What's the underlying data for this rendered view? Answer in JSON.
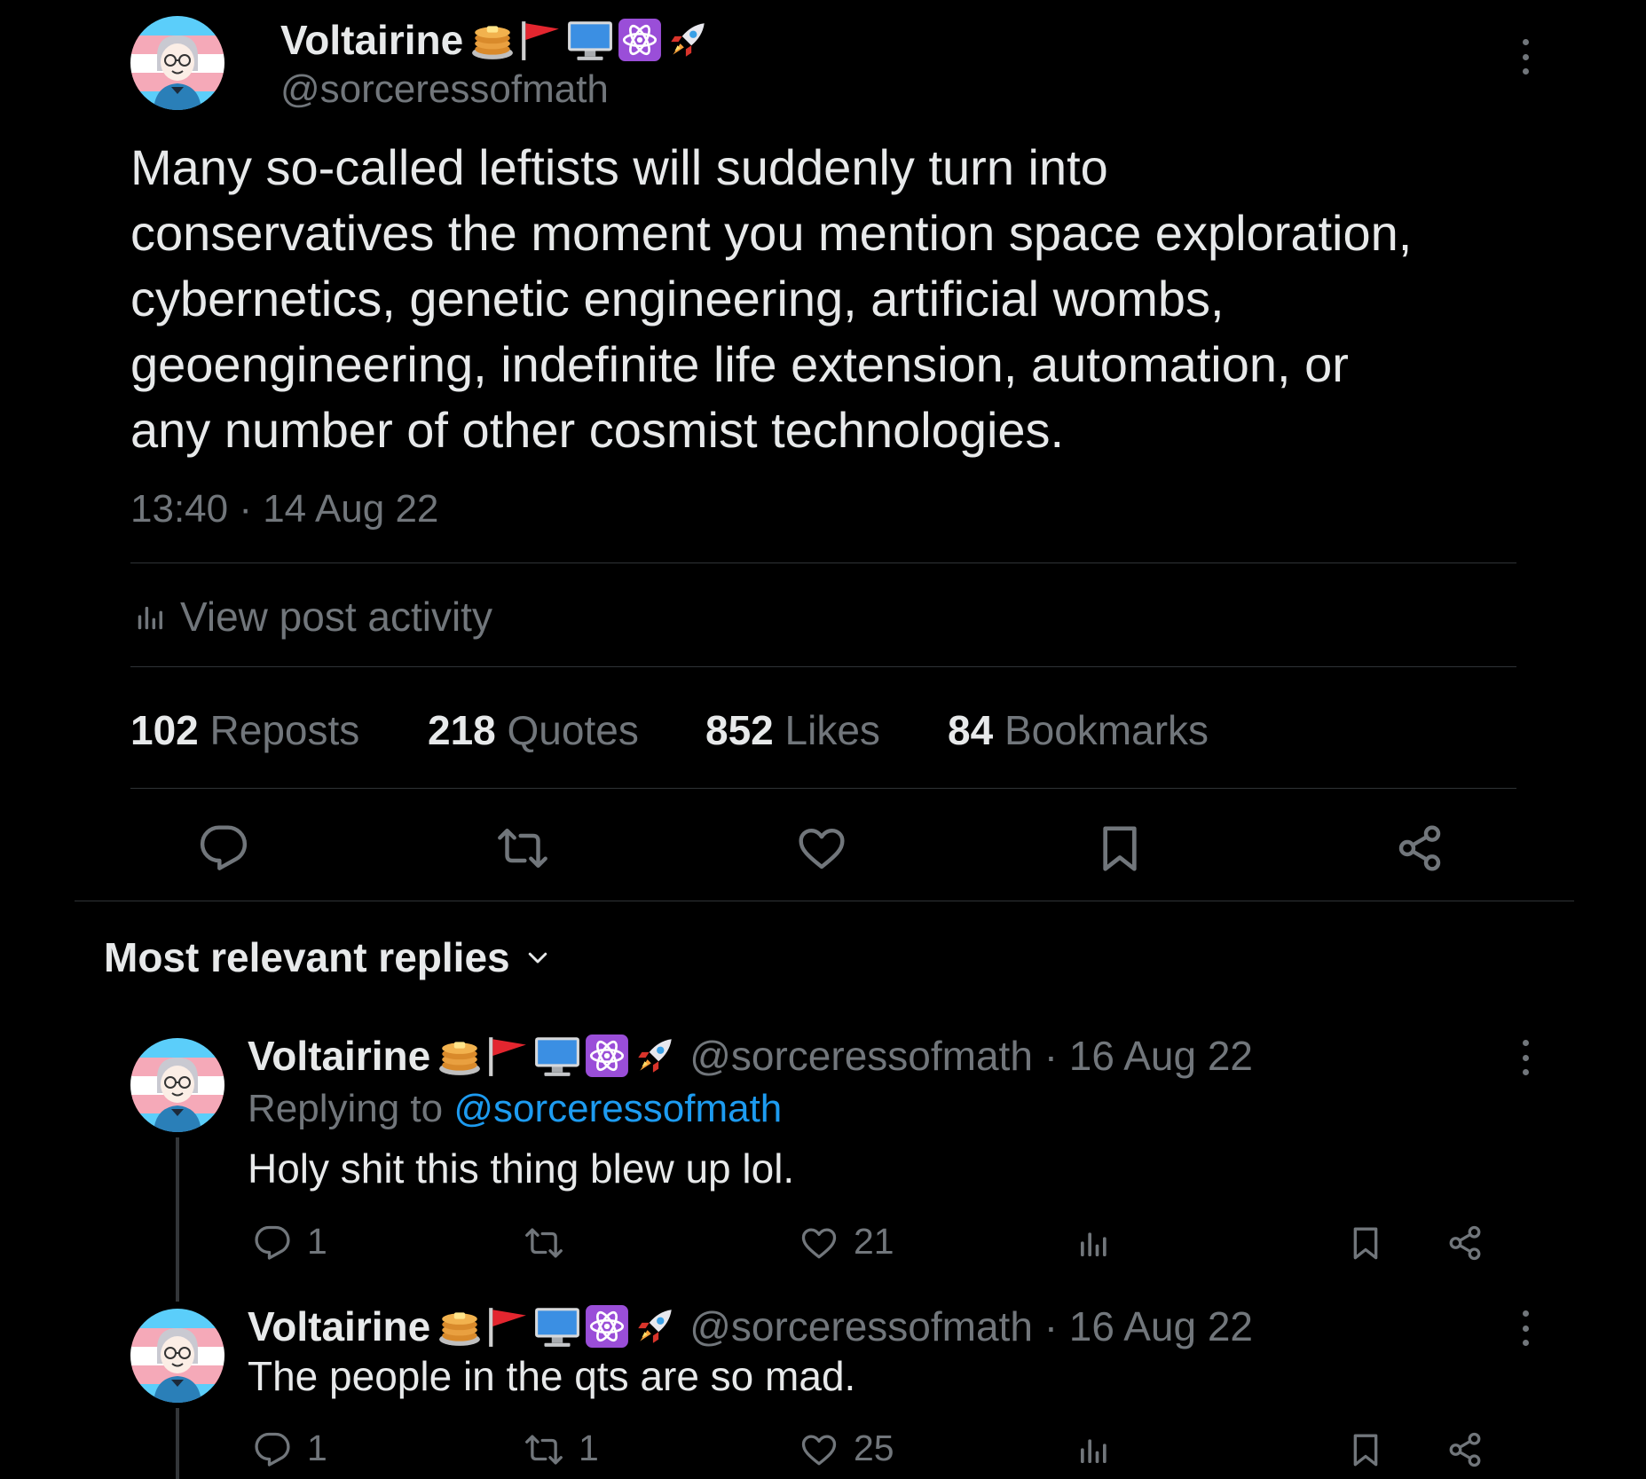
{
  "post": {
    "author_name": "Voltairine",
    "author_handle": "@sorceressofmath",
    "body_lines": [
      "Many so-called leftists will suddenly turn into",
      "conservatives the moment you mention space exploration,",
      "cybernetics, genetic engineering, artificial wombs,",
      "geoengineering, indefinite life extension, automation, or",
      "any number of other cosmist technologies."
    ],
    "timestamp": "13:40 · 14 Aug 22",
    "view_activity": "View post activity",
    "stats": [
      {
        "count": "102",
        "label": "Reposts"
      },
      {
        "count": "218",
        "label": "Quotes"
      },
      {
        "count": "852",
        "label": "Likes"
      },
      {
        "count": "84",
        "label": "Bookmarks"
      }
    ],
    "emoji_icons": [
      "pancakes-icon",
      "red-flag-icon",
      "desktop-computer-icon",
      "atom-symbol-icon",
      "rocket-icon"
    ]
  },
  "replies_header": {
    "label": "Most relevant replies"
  },
  "replies": [
    {
      "author_name": "Voltairine",
      "handle_date": "@sorceressofmath · 16 Aug 22",
      "replying_prefix": "Replying to",
      "replying_to": "@sorceressofmath",
      "text": "Holy shit this thing blew up lol.",
      "reply_count": "1",
      "repost_count": "",
      "like_count": "21"
    },
    {
      "author_name": "Voltairine",
      "handle_date": "@sorceressofmath · 16 Aug 22",
      "text": "The people in the qts are so mad.",
      "reply_count": "1",
      "repost_count": "1",
      "like_count": "25"
    }
  ],
  "colors": {
    "background": "#000000",
    "text": "#e7e9ea",
    "muted": "#71767b",
    "link": "#1d9bf0",
    "divider": "#2f3336"
  }
}
